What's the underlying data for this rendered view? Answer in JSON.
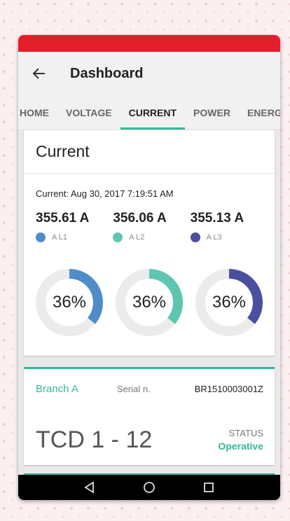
{
  "appbar": {
    "title": "Dashboard",
    "back_icon": "arrow-back-icon"
  },
  "tabs": [
    {
      "label": "HOME",
      "active": false
    },
    {
      "label": "VOLTAGE",
      "active": false
    },
    {
      "label": "CURRENT",
      "active": true
    },
    {
      "label": "POWER",
      "active": false
    },
    {
      "label": "ENERGY",
      "active": false
    }
  ],
  "current_card": {
    "title": "Current",
    "timestamp": "Current: Aug 30, 2017 7:19:51 AM",
    "readings": [
      {
        "value": "355.61 A",
        "legend": "A L1",
        "color": "#4f8cca"
      },
      {
        "value": "356.06 A",
        "legend": "A L2",
        "color": "#5dc6b1"
      },
      {
        "value": "355.13 A",
        "legend": "A L3",
        "color": "#4a4f9f"
      }
    ],
    "gauges": [
      {
        "label": "36%",
        "percent": 36,
        "color": "#4f8cca"
      },
      {
        "label": "36%",
        "percent": 36,
        "color": "#5dc6b1"
      },
      {
        "label": "36%",
        "percent": 36,
        "color": "#4a4f9f"
      }
    ]
  },
  "branch_card": {
    "branch": "Branch A",
    "serial_label": "Serial n.",
    "serial_value": "BR1510003001Z",
    "device": "TCD 1 - 12",
    "status_label": "STATUS",
    "status_value": "Operative"
  },
  "colors": {
    "status_bar": "#e41e2b",
    "accent": "#35b79a",
    "gauge_track": "#ebebeb"
  },
  "navbar": {
    "icons": [
      "nav-back-icon",
      "nav-home-icon",
      "nav-recents-icon"
    ]
  }
}
